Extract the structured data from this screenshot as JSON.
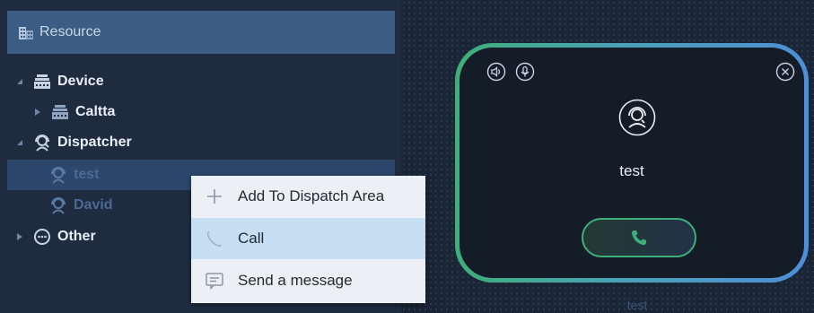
{
  "panel": {
    "title": "Resource",
    "tree": {
      "device": "Device",
      "caltta": "Caltta",
      "dispatcher": "Dispatcher",
      "test": "test",
      "david": "David",
      "other": "Other"
    }
  },
  "context_menu": {
    "items": [
      {
        "label": "Add To Dispatch Area",
        "icon": "plus-icon"
      },
      {
        "label": "Call",
        "icon": "phone-icon"
      },
      {
        "label": "Send a message",
        "icon": "message-icon"
      }
    ]
  },
  "call_card": {
    "name": "test",
    "icons": [
      "speaker-icon",
      "microphone-icon",
      "close-icon",
      "dispatcher-icon",
      "phone-icon"
    ]
  },
  "dispatch_area": {
    "bottom_label": "test"
  },
  "colors": {
    "panel_bg": "#1f2c40",
    "header_bg": "#3b5d84",
    "selected_row": "#2c476b",
    "menu_bg": "#eceff3",
    "menu_hover": "#c6dff2",
    "card_border_start": "#3fae78",
    "card_border_end": "#4d8fd6",
    "call_green": "#3fae78"
  }
}
